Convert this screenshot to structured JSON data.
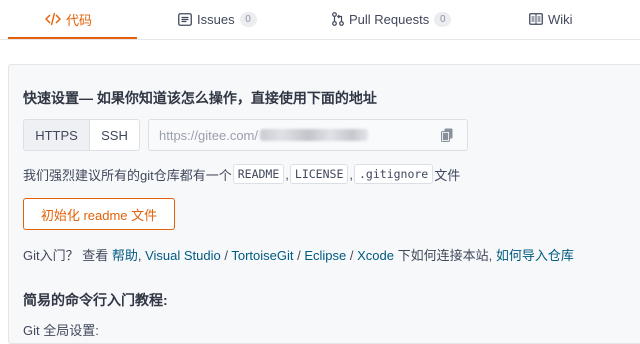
{
  "tabs": [
    {
      "label": "代码",
      "icon": "code-icon",
      "active": true
    },
    {
      "label": "Issues",
      "icon": "issues-icon",
      "count": "0"
    },
    {
      "label": "Pull Requests",
      "icon": "pull-request-icon",
      "count": "0"
    },
    {
      "label": "Wiki",
      "icon": "wiki-icon"
    }
  ],
  "quick_setup": {
    "heading": "快速设置— 如果你知道该怎么操作，直接使用下面的地址",
    "protocols": [
      "HTTPS",
      "SSH"
    ],
    "selected_protocol": "HTTPS",
    "url_prefix": "https://gitee.com/"
  },
  "recommend": {
    "prefix": "我们强烈建议所有的git仓库都有一个",
    "files": [
      "README",
      "LICENSE",
      ".gitignore"
    ],
    "sep1": ",",
    "sep2": ",",
    "suffix": "文件"
  },
  "init_button": "初始化 readme 文件",
  "help": {
    "prefix": "Git入门？ 查看 ",
    "link_help": "帮助",
    "sep1": ", ",
    "link_vs": "Visual Studio",
    "sep2": " / ",
    "link_tortoise": "TortoiseGit",
    "sep3": " / ",
    "link_eclipse": "Eclipse",
    "sep4": " / ",
    "link_xcode": "Xcode",
    "middle": " 下如何连接本站, ",
    "link_import": "如何导入仓库"
  },
  "tutorial_heading": "简易的命令行入门教程:",
  "cutoff_text": "Git 全局设置:",
  "colors": {
    "accent": "#e36209",
    "link": "#005980",
    "panel_bg": "#f7f8fa"
  }
}
